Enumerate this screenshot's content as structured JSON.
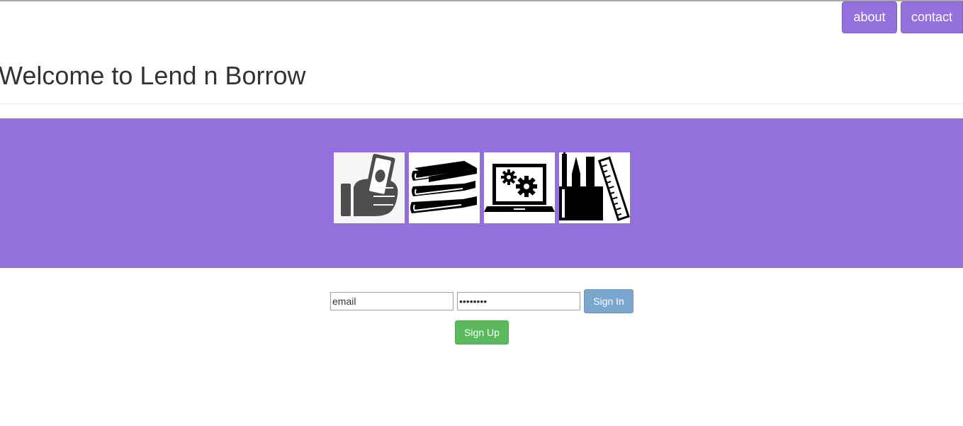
{
  "nav": {
    "about_label": "about",
    "contact_label": "contact"
  },
  "header": {
    "title": "Welcome to Lend n Borrow"
  },
  "banner": {
    "icons": [
      "money-hand-icon",
      "books-icon",
      "laptop-gears-icon",
      "stationery-icon"
    ]
  },
  "login": {
    "email_placeholder": "email",
    "password_value": "password",
    "signin_label": "Sign In",
    "signup_label": "Sign Up"
  },
  "colors": {
    "accent": "#9370db",
    "signin": "#7ba7cf",
    "signup": "#5cb85c"
  }
}
